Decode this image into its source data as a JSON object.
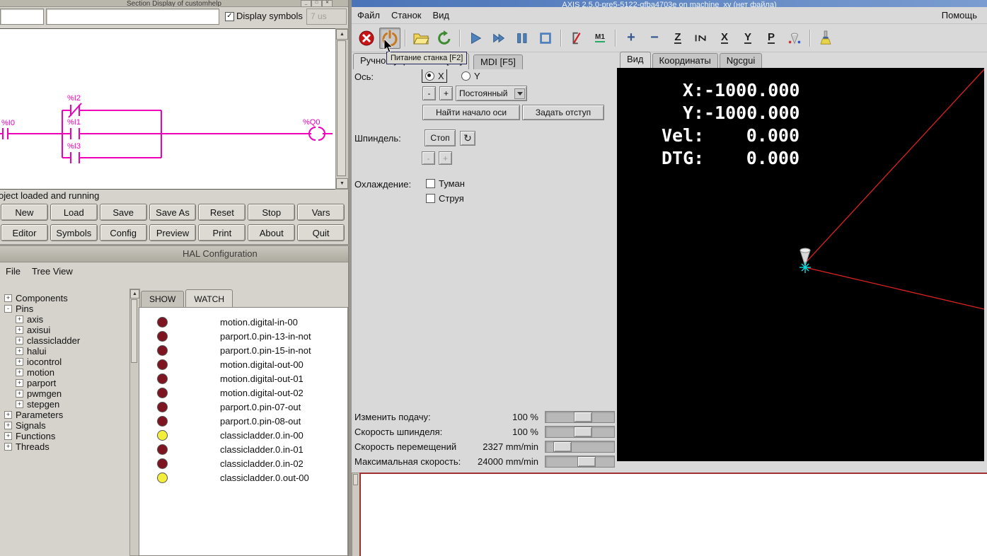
{
  "theme": {
    "ladder_color": "#ee00bb",
    "led_on": "#f2ee3b",
    "led_off": "#7e1420",
    "titlebar_blue": "#4a74b8",
    "dro": "#ffffff",
    "preview_line": "#dd2222",
    "marker": "#00dede"
  },
  "classicladder": {
    "title": "Section Display of customhelp",
    "display_symbols_label": "Display symbols",
    "display_symbols_checked": "✓",
    "scan_time": "7 us",
    "status": "Project loaded and running",
    "ladder_labels": {
      "i0": "%I0",
      "i1": "%I1",
      "i2": "%I2",
      "i3": "%I3",
      "q0": "%Q0"
    },
    "buttons_row1": [
      "New",
      "Load",
      "Save",
      "Save As",
      "Reset",
      "Stop",
      "Vars"
    ],
    "buttons_row2": [
      "Editor",
      "Symbols",
      "Config",
      "Preview",
      "Print",
      "About",
      "Quit"
    ]
  },
  "hal": {
    "title": "HAL Configuration",
    "menus": [
      "File",
      "Tree View"
    ],
    "tabs": {
      "show": "SHOW",
      "watch": "WATCH"
    },
    "tree": [
      {
        "label": "Components",
        "level": 0,
        "box": "+"
      },
      {
        "label": "Pins",
        "level": 0,
        "box": "-"
      },
      {
        "label": "axis",
        "level": 1,
        "box": "+"
      },
      {
        "label": "axisui",
        "level": 1,
        "box": "+"
      },
      {
        "label": "classicladder",
        "level": 1,
        "box": "+"
      },
      {
        "label": "halui",
        "level": 1,
        "box": "+"
      },
      {
        "label": "iocontrol",
        "level": 1,
        "box": "+"
      },
      {
        "label": "motion",
        "level": 1,
        "box": "+"
      },
      {
        "label": "parport",
        "level": 1,
        "box": "+"
      },
      {
        "label": "pwmgen",
        "level": 1,
        "box": "+"
      },
      {
        "label": "stepgen",
        "level": 1,
        "box": "+"
      },
      {
        "label": "Parameters",
        "level": 0,
        "box": "+"
      },
      {
        "label": "Signals",
        "level": 0,
        "box": "+"
      },
      {
        "label": "Functions",
        "level": 0,
        "box": "+"
      },
      {
        "label": "Threads",
        "level": 0,
        "box": "+"
      }
    ],
    "watch": [
      {
        "name": "motion.digital-in-00",
        "on": false
      },
      {
        "name": "parport.0.pin-13-in-not",
        "on": false
      },
      {
        "name": "parport.0.pin-15-in-not",
        "on": false
      },
      {
        "name": "motion.digital-out-00",
        "on": false
      },
      {
        "name": "motion.digital-out-01",
        "on": false
      },
      {
        "name": "motion.digital-out-02",
        "on": false
      },
      {
        "name": "parport.0.pin-07-out",
        "on": false
      },
      {
        "name": "parport.0.pin-08-out",
        "on": false
      },
      {
        "name": "classicladder.0.in-00",
        "on": true
      },
      {
        "name": "classicladder.0.in-01",
        "on": false
      },
      {
        "name": "classicladder.0.in-02",
        "on": false
      },
      {
        "name": "classicladder.0.out-00",
        "on": true
      }
    ]
  },
  "axis": {
    "title": "AXIS 2.5.0-pre5-5122-gfba4703e on machine_xy (нет файла)",
    "menus": [
      "Файл",
      "Станок",
      "Вид"
    ],
    "help_menu": "Помощь",
    "power_tooltip": "Питание станка [F2]",
    "toolbar_icons": [
      "estop",
      "machine-power",
      "open-file",
      "reload-file",
      "run-program",
      "step-program",
      "pause-program",
      "stop-program",
      "skip-lines",
      "optional-pause",
      "zoom-in",
      "zoom-out",
      "view-z",
      "view-z-rotated",
      "view-x",
      "view-y",
      "view-perspective",
      "rotate-view",
      "clear-plot"
    ],
    "tabs": {
      "manual": "Ручное управление [F3]",
      "mdi": "MDI [F5]"
    },
    "preview_tabs": [
      {
        "label": "Вид",
        "active": true
      },
      {
        "label": "Координаты",
        "active": false
      },
      {
        "label": "Ngcgui",
        "active": false
      }
    ],
    "manual": {
      "axis_label": "Ось:",
      "axis_x": "X",
      "axis_y": "Y",
      "jog_minus": "-",
      "jog_plus": "+",
      "jog_mode": "Постоянный",
      "home_button": "Найти начало оси",
      "touchoff_button": "Задать отступ",
      "spindle_label": "Шпиндель:",
      "spindle_stop": "Стоп",
      "spindle_minus": "-",
      "spindle_plus": "+",
      "coolant_label": "Охлаждение:",
      "mist_label": "Туман",
      "flood_label": "Струя"
    },
    "dro": [
      {
        "label": "X:",
        "value": "-1000.000"
      },
      {
        "label": "Y:",
        "value": "-1000.000"
      },
      {
        "label": "Vel:",
        "value": "0.000"
      },
      {
        "label": "DTG:",
        "value": "0.000"
      }
    ],
    "sliders": [
      {
        "label": "Изменить подачу:",
        "value": "100 %",
        "handle": 0.55
      },
      {
        "label": "Скорость шпинделя:",
        "value": "100 %",
        "handle": 0.55
      },
      {
        "label": "Скорость перемещений",
        "value": "2327 mm/min",
        "handle": 0.15
      },
      {
        "label": "Максимальная скорость:",
        "value": "24000 mm/min",
        "handle": 0.62
      }
    ]
  }
}
